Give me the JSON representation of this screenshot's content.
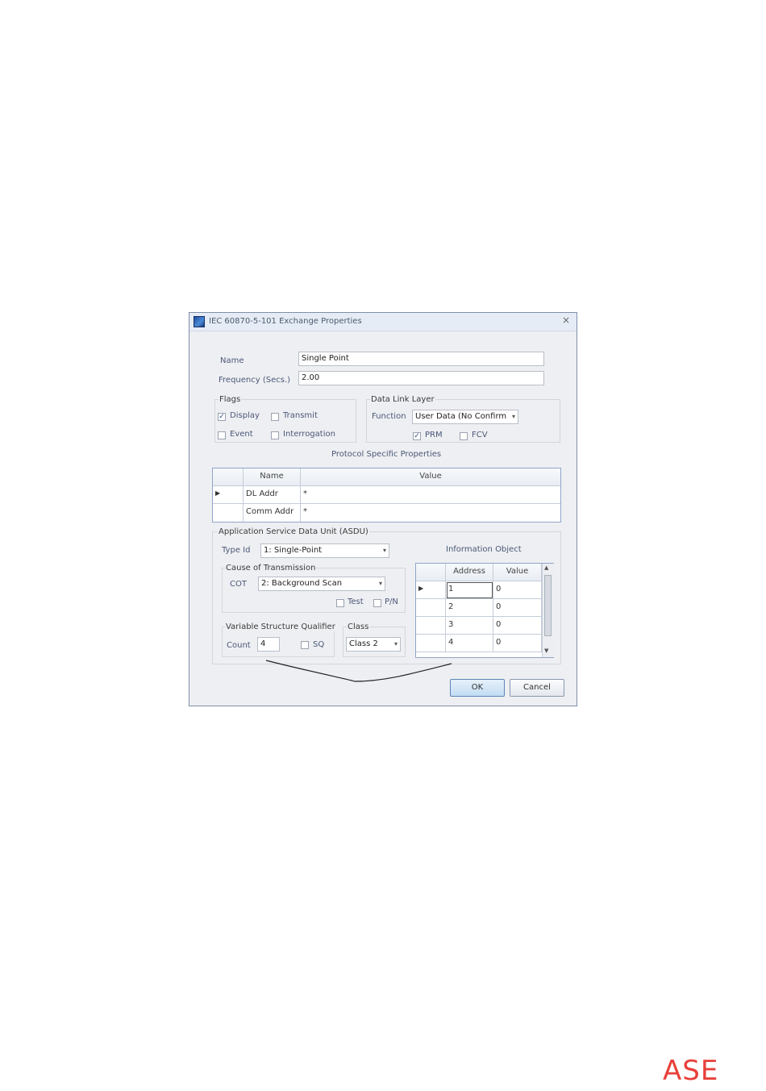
{
  "dialog": {
    "title": "IEC 60870-5-101 Exchange Properties",
    "close_glyph": "×",
    "name_label": "Name",
    "name_value": "Single Point",
    "frequency_label": "Frequency (Secs.)",
    "frequency_value": "2.00",
    "flags": {
      "title": "Flags",
      "display": {
        "label": "Display",
        "checked": true
      },
      "transmit": {
        "label": "Transmit",
        "checked": false
      },
      "event": {
        "label": "Event",
        "checked": false
      },
      "interrogation": {
        "label": "Interrogation",
        "checked": false
      }
    },
    "data_link_layer": {
      "title": "Data Link Layer",
      "function_label": "Function",
      "function_value": "User Data (No Confirm",
      "prm": {
        "label": "PRM",
        "checked": true
      },
      "fcv": {
        "label": "FCV",
        "checked": false
      }
    },
    "protocol_specific": {
      "title": "Protocol Specific Properties",
      "columns": [
        "Name",
        "Value"
      ],
      "rows": [
        {
          "name": "DL Addr",
          "value": "*"
        },
        {
          "name": "Comm Addr",
          "value": "*"
        }
      ]
    },
    "asdu": {
      "title": "Application Service Data Unit (ASDU)",
      "type_id_label": "Type Id",
      "type_id_value": "1: Single-Point",
      "cot_group_title": "Cause of Transmission",
      "cot_label": "COT",
      "cot_value": "2: Background Scan",
      "test": {
        "label": "Test",
        "checked": false
      },
      "pn": {
        "label": "P/N",
        "checked": false
      },
      "vsq_title": "Variable Structure Qualifier",
      "count_label": "Count",
      "count_value": "4",
      "sq": {
        "label": "SQ",
        "checked": false
      },
      "class_title": "Class",
      "class_value": "Class 2"
    },
    "information_object": {
      "title": "Information Object",
      "columns": [
        "Address",
        "Value"
      ],
      "rows": [
        {
          "address": "1",
          "value": "0"
        },
        {
          "address": "2",
          "value": "0"
        },
        {
          "address": "3",
          "value": "0"
        },
        {
          "address": "4",
          "value": "0"
        }
      ]
    },
    "buttons": {
      "ok": "OK",
      "cancel": "Cancel"
    }
  },
  "footer_logo": "ASE",
  "colors": {
    "logo": "#e8403a",
    "dialog_border": "#7f8fa8",
    "grid_border": "#8fa5c8"
  }
}
